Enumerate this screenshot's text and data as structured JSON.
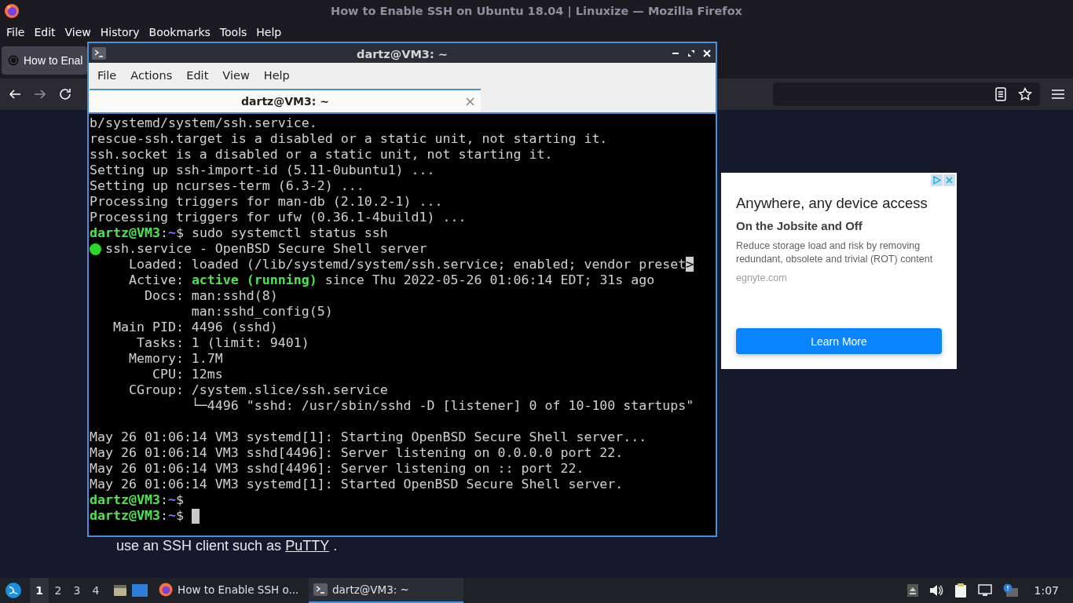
{
  "browser": {
    "title": "How to Enable SSH on Ubuntu 18.04 | Linuxize — Mozilla Firefox",
    "menu": [
      "File",
      "Edit",
      "View",
      "History",
      "Bookmarks",
      "Tools",
      "Help"
    ],
    "tabs": [
      {
        "label": "How to Enal",
        "selected": true
      }
    ],
    "page": {
      "ad": {
        "headline": "Anywhere, any device access",
        "subheadline": "On the Jobsite and Off",
        "body": "Reduce storage load and risk by removing redundant, obsolete and trivial (ROT) content",
        "domain": "egnyte.com",
        "button": "Learn More"
      },
      "text_before_link": "use an SSH client such as",
      "link": "PuTTY",
      "text_after_link": "."
    }
  },
  "terminal": {
    "title": "dartz@VM3: ~",
    "menu": [
      "File",
      "Actions",
      "Edit",
      "View",
      "Help"
    ],
    "tabs": [
      {
        "label": "dartz@VM3: ~",
        "selected": true
      }
    ],
    "cursor_visible": true,
    "lines": [
      {
        "kind": "text",
        "segments": [
          {
            "kind": "plain",
            "text": "b/systemd/system/ssh.service."
          }
        ]
      },
      {
        "kind": "text",
        "segments": [
          {
            "kind": "plain",
            "text": "rescue-ssh.target is a disabled or a static unit, not starting it."
          }
        ]
      },
      {
        "kind": "text",
        "segments": [
          {
            "kind": "plain",
            "text": "ssh.socket is a disabled or a static unit, not starting it."
          }
        ]
      },
      {
        "kind": "text",
        "segments": [
          {
            "kind": "plain",
            "text": "Setting up ssh-import-id (5.11-0ubuntu1) ..."
          }
        ]
      },
      {
        "kind": "text",
        "segments": [
          {
            "kind": "plain",
            "text": "Setting up ncurses-term (6.3-2) ..."
          }
        ]
      },
      {
        "kind": "text",
        "segments": [
          {
            "kind": "plain",
            "text": "Processing triggers for man-db (2.10.2-1) ..."
          }
        ]
      },
      {
        "kind": "text",
        "segments": [
          {
            "kind": "plain",
            "text": "Processing triggers for ufw (0.36.1-4build1) ..."
          }
        ]
      },
      {
        "kind": "text",
        "segments": [
          {
            "kind": "user",
            "text": "dartz@VM3"
          },
          {
            "kind": "plain",
            "text": ":"
          },
          {
            "kind": "path",
            "text": "~"
          },
          {
            "kind": "plain",
            "text": "$ sudo systemctl status ssh"
          }
        ]
      },
      {
        "kind": "status",
        "segments": [
          {
            "kind": "plain",
            "text": "ssh.service - OpenBSD Secure Shell server"
          }
        ]
      },
      {
        "kind": "text",
        "segments": [
          {
            "kind": "plain",
            "text": "     Loaded: loaded (/lib/systemd/system/ssh.service; enabled; vendor preset"
          },
          {
            "kind": "inverse",
            "text": ">"
          }
        ]
      },
      {
        "kind": "text",
        "segments": [
          {
            "kind": "plain",
            "text": "     Active: "
          },
          {
            "kind": "ok",
            "text": "active (running)"
          },
          {
            "kind": "plain",
            "text": " since Thu 2022-05-26 01:06:14 EDT; 31s ago"
          }
        ]
      },
      {
        "kind": "text",
        "segments": [
          {
            "kind": "plain",
            "text": "       Docs: man:sshd(8)"
          }
        ]
      },
      {
        "kind": "text",
        "segments": [
          {
            "kind": "plain",
            "text": "             man:sshd_config(5)"
          }
        ]
      },
      {
        "kind": "text",
        "segments": [
          {
            "kind": "plain",
            "text": "   Main PID: 4496 (sshd)"
          }
        ]
      },
      {
        "kind": "text",
        "segments": [
          {
            "kind": "plain",
            "text": "      Tasks: 1 (limit: 9401)"
          }
        ]
      },
      {
        "kind": "text",
        "segments": [
          {
            "kind": "plain",
            "text": "     Memory: 1.7M"
          }
        ]
      },
      {
        "kind": "text",
        "segments": [
          {
            "kind": "plain",
            "text": "        CPU: 12ms"
          }
        ]
      },
      {
        "kind": "text",
        "segments": [
          {
            "kind": "plain",
            "text": "     CGroup: /system.slice/ssh.service"
          }
        ]
      },
      {
        "kind": "text",
        "segments": [
          {
            "kind": "plain",
            "text": "             └─4496 \"sshd: /usr/sbin/sshd -D [listener] 0 of 10-100 startups\""
          }
        ]
      },
      {
        "kind": "blank"
      },
      {
        "kind": "text",
        "segments": [
          {
            "kind": "plain",
            "text": "May 26 01:06:14 VM3 systemd[1]: Starting OpenBSD Secure Shell server..."
          }
        ]
      },
      {
        "kind": "text",
        "segments": [
          {
            "kind": "plain",
            "text": "May 26 01:06:14 VM3 sshd[4496]: Server listening on 0.0.0.0 port 22."
          }
        ]
      },
      {
        "kind": "text",
        "segments": [
          {
            "kind": "plain",
            "text": "May 26 01:06:14 VM3 sshd[4496]: Server listening on :: port 22."
          }
        ]
      },
      {
        "kind": "text",
        "segments": [
          {
            "kind": "plain",
            "text": "May 26 01:06:14 VM3 systemd[1]: Started OpenBSD Secure Shell server."
          }
        ]
      },
      {
        "kind": "text",
        "segments": [
          {
            "kind": "user",
            "text": "dartz@VM3"
          },
          {
            "kind": "plain",
            "text": ":"
          },
          {
            "kind": "path",
            "text": "~"
          },
          {
            "kind": "plain",
            "text": "$"
          }
        ]
      },
      {
        "kind": "text",
        "segments": [
          {
            "kind": "user",
            "text": "dartz@VM3"
          },
          {
            "kind": "plain",
            "text": ":"
          },
          {
            "kind": "path",
            "text": "~"
          },
          {
            "kind": "plain",
            "text": "$ "
          }
        ]
      }
    ]
  },
  "taskbar": {
    "workspaces": [
      {
        "label": "1",
        "selected": true
      },
      {
        "label": "2",
        "selected": false
      },
      {
        "label": "3",
        "selected": false
      },
      {
        "label": "4",
        "selected": false
      }
    ],
    "tasks": [
      {
        "kind": "browser",
        "label": "How to Enable SSH o...",
        "selected": false
      },
      {
        "kind": "terminal",
        "label": "dartz@VM3: ~",
        "selected": true
      }
    ],
    "clock": "1:07"
  }
}
